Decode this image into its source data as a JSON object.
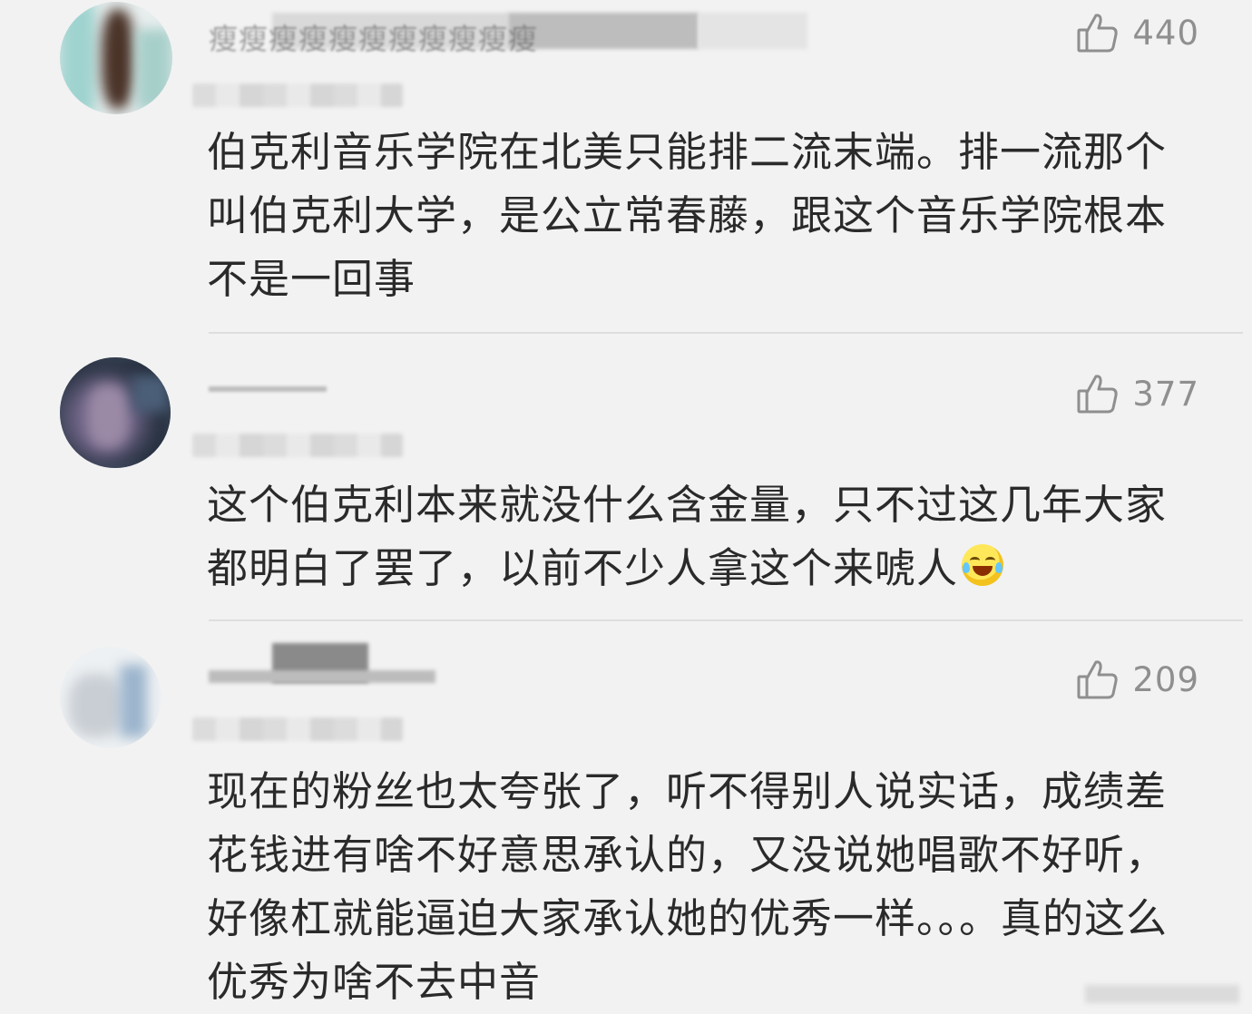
{
  "comments": [
    {
      "username": "瘦瘦瘦瘦瘦瘦瘦瘦瘦瘦瘦",
      "likes": "440",
      "text": "伯克利音乐学院在北美只能排二流末端。排一流那个叫伯克利大学，是公立常春藤，跟这个音乐学院根本不是一回事",
      "avatar_icon": "user-avatar-blurred"
    },
    {
      "username": "",
      "likes": "377",
      "text": "这个伯克利本来就没什么含金量，只不过这几年大家都明白了罢了，以前不少人拿这个来唬人",
      "emoji": "laugh-cry-emoji",
      "avatar_icon": "user-avatar-blurred"
    },
    {
      "username": "",
      "likes": "209",
      "text": "现在的粉丝也太夸张了，听不得别人说实话，成绩差花钱进有啥不好意思承认的，又没说她唱歌不好听，好像杠就能逼迫大家承认她的优秀一样。。。真的这么优秀为啥不去中音",
      "avatar_icon": "user-avatar-blurred"
    }
  ],
  "icons": {
    "like": "thumbs-up-icon"
  },
  "colors": {
    "background": "#f2f2f2",
    "text": "#2a2a2a",
    "meta": "#8f8f8f",
    "divider": "#dedede"
  }
}
